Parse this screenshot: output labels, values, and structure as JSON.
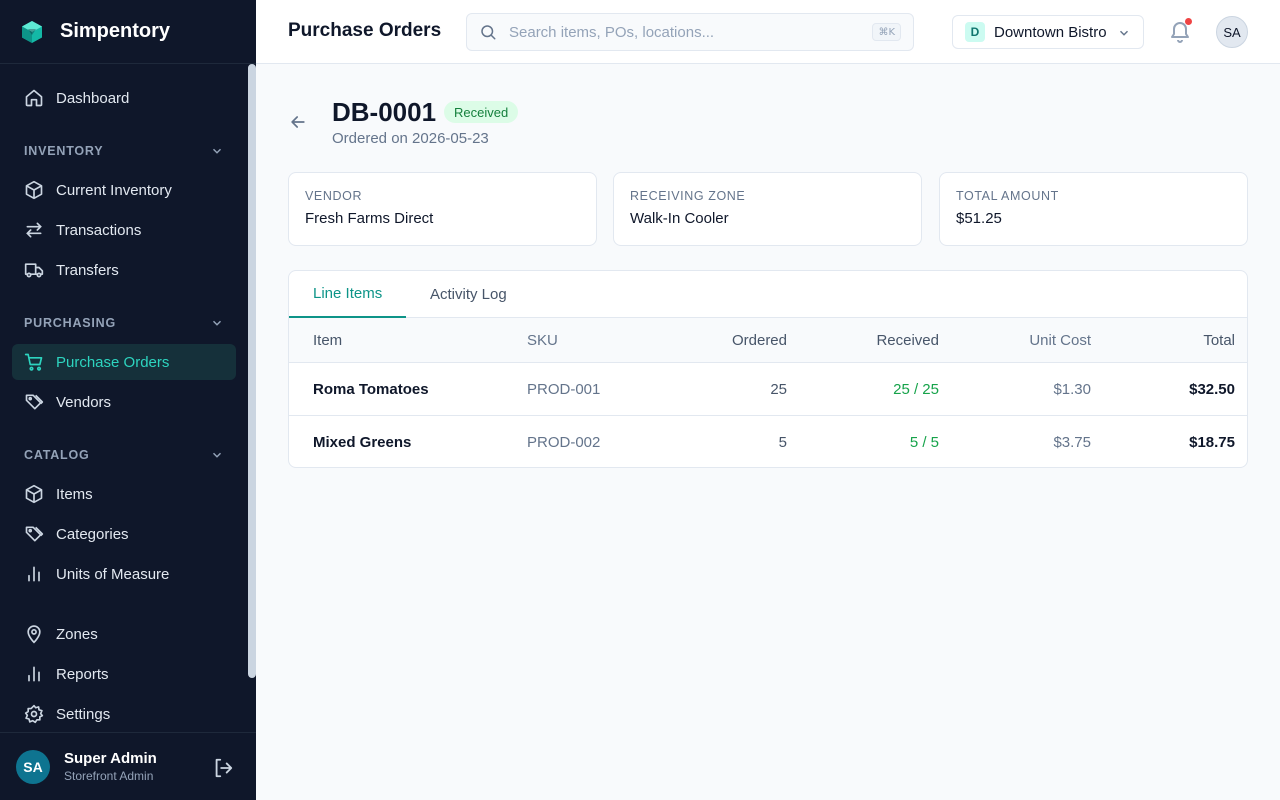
{
  "app": {
    "name": "Simpentory"
  },
  "sidebar": {
    "dashboard": "Dashboard",
    "sections": {
      "inventory": "INVENTORY",
      "purchasing": "PURCHASING",
      "catalog": "CATALOG"
    },
    "items": {
      "current_inventory": "Current Inventory",
      "transactions": "Transactions",
      "transfers": "Transfers",
      "purchase_orders": "Purchase Orders",
      "vendors": "Vendors",
      "items": "Items",
      "categories": "Categories",
      "units_of_measure": "Units of Measure",
      "zones": "Zones",
      "reports": "Reports",
      "settings": "Settings"
    },
    "active_item": "purchase_orders",
    "user": {
      "initials": "SA",
      "name": "Super Admin",
      "role": "Storefront Admin"
    }
  },
  "header": {
    "title": "Purchase Orders",
    "search_placeholder": "Search items, POs, locations...",
    "search_shortcut": "⌘K",
    "location": {
      "initial": "D",
      "name": "Downtown Bistro"
    },
    "avatar_initials": "SA"
  },
  "po": {
    "number": "DB-0001",
    "status": "Received",
    "ordered_on": "Ordered on 2026-05-23",
    "cards": [
      {
        "label": "VENDOR",
        "value": "Fresh Farms Direct"
      },
      {
        "label": "RECEIVING ZONE",
        "value": "Walk-In Cooler"
      },
      {
        "label": "TOTAL AMOUNT",
        "value": "$51.25"
      }
    ],
    "tabs": [
      "Line Items",
      "Activity Log"
    ],
    "active_tab": "Line Items",
    "table": {
      "columns": [
        "Item",
        "SKU",
        "Ordered",
        "Received",
        "Unit Cost",
        "Total"
      ],
      "rows": [
        {
          "item": "Roma Tomatoes",
          "sku": "PROD-001",
          "ordered": "25",
          "received": "25 / 25",
          "unit_cost": "$1.30",
          "total": "$32.50"
        },
        {
          "item": "Mixed Greens",
          "sku": "PROD-002",
          "ordered": "5",
          "received": "5 / 5",
          "unit_cost": "$3.75",
          "total": "$18.75"
        }
      ]
    }
  },
  "colors": {
    "sidebar_bg": "#0f172a",
    "accent": "#0d9488",
    "active_nav_text": "#2dd4bf",
    "status_green": "#16a34a",
    "notification_dot": "#ef4444"
  }
}
